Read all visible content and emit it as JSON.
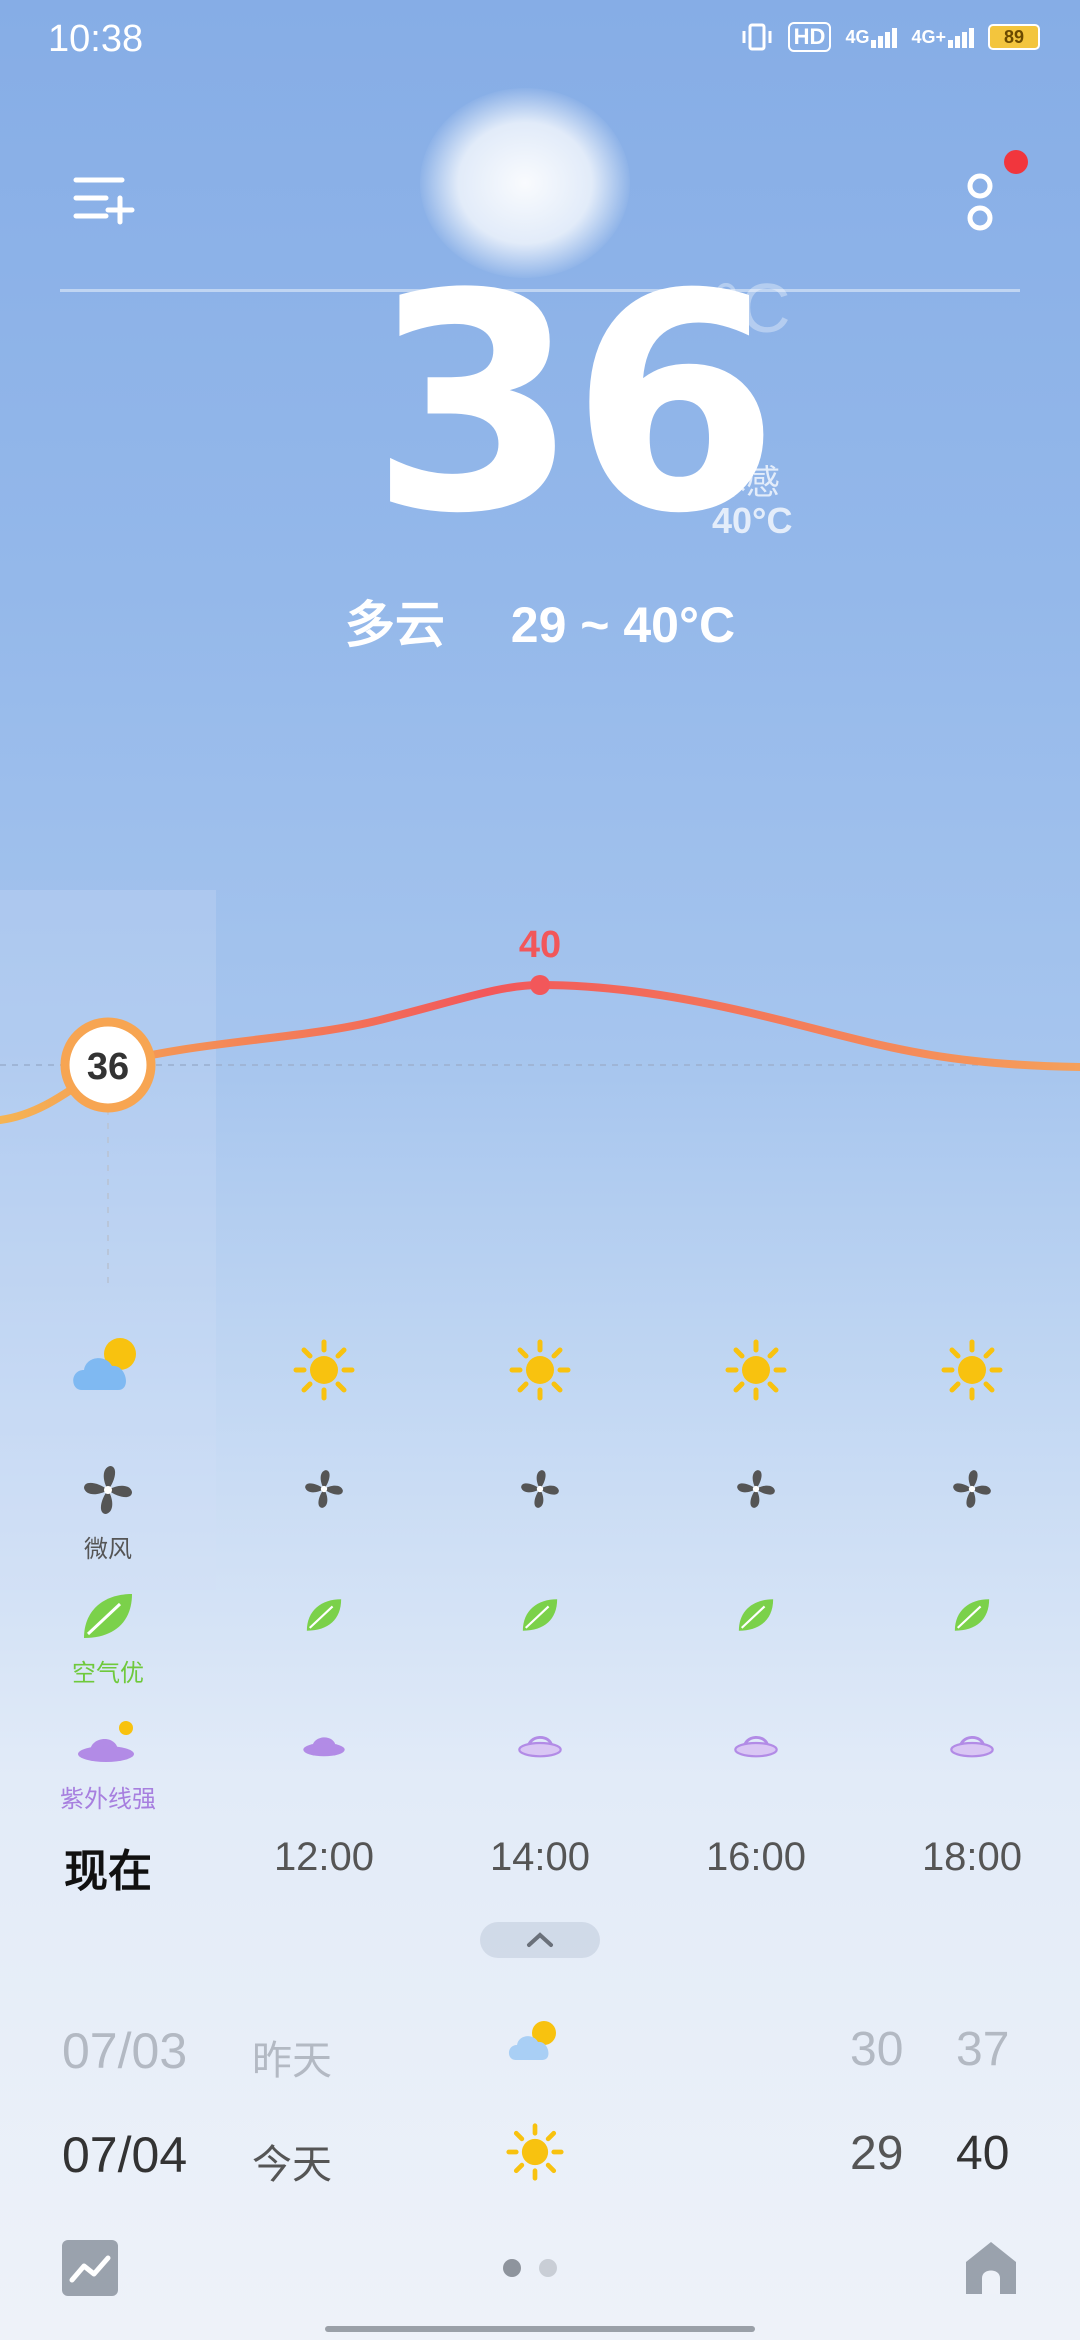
{
  "status_bar": {
    "time": "10:38",
    "hd_badge": "HD",
    "net1": "4G",
    "net2": "4G+",
    "battery": "89"
  },
  "current": {
    "temperature": "36",
    "degree_symbol": "°C",
    "feels_label": "体感",
    "feels_value": "40°C",
    "condition": "多云",
    "range": "29 ~ 40°C"
  },
  "hourly": {
    "current_temp": "36",
    "peak_temp": "40",
    "slots": [
      {
        "time": "现在",
        "weather_icon": "partly-cloudy-icon",
        "wind_label": "微风",
        "air_label": "空气优",
        "uv_label": "紫外线强"
      },
      {
        "time": "12:00",
        "weather_icon": "sun-icon"
      },
      {
        "time": "14:00",
        "weather_icon": "sun-icon"
      },
      {
        "time": "16:00",
        "weather_icon": "sun-icon"
      },
      {
        "time": "18:00",
        "weather_icon": "sun-icon"
      }
    ]
  },
  "daily": [
    {
      "date": "07/03",
      "day": "昨天",
      "icon": "partly-cloudy-icon",
      "low": "30",
      "high": "37"
    },
    {
      "date": "07/04",
      "day": "今天",
      "icon": "sun-icon",
      "low": "29",
      "high": "40"
    }
  ],
  "colors": {
    "curve_start": "#f5b454",
    "curve_peak": "#f2575a",
    "sun": "#f8c20f",
    "leaf": "#7bd14a",
    "uv_purple": "#b28be6",
    "badge": "#f7a552"
  }
}
